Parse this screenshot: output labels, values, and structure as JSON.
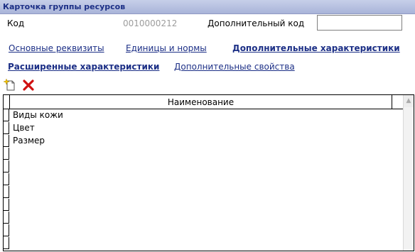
{
  "window": {
    "title": "Карточка группы ресурсов"
  },
  "form": {
    "code_label": "Код",
    "code_value": "0010000212",
    "additional_code_label": "Дополнительный код",
    "additional_code_value": ""
  },
  "tabs": [
    {
      "label": "Основные реквизиты",
      "active": false
    },
    {
      "label": "Единицы и нормы",
      "active": false
    },
    {
      "label": "Дополнительные характеристики",
      "active": false
    },
    {
      "label": "Расширенные характеристики",
      "active": true
    },
    {
      "label": "Дополнительные свойства",
      "active": false
    }
  ],
  "toolbar": {
    "add_icon": "add-document-icon",
    "delete_icon": "delete-x-icon"
  },
  "grid": {
    "column_header": "Наименование",
    "rows": [
      "Виды кожи",
      "Цвет",
      "Размер"
    ]
  },
  "colors": {
    "title_text": "#1c2f86",
    "title_bar": "#b8c1e2",
    "link": "#1c2f86",
    "code_value": "#9c9c9c",
    "delete_icon": "#d01010"
  }
}
